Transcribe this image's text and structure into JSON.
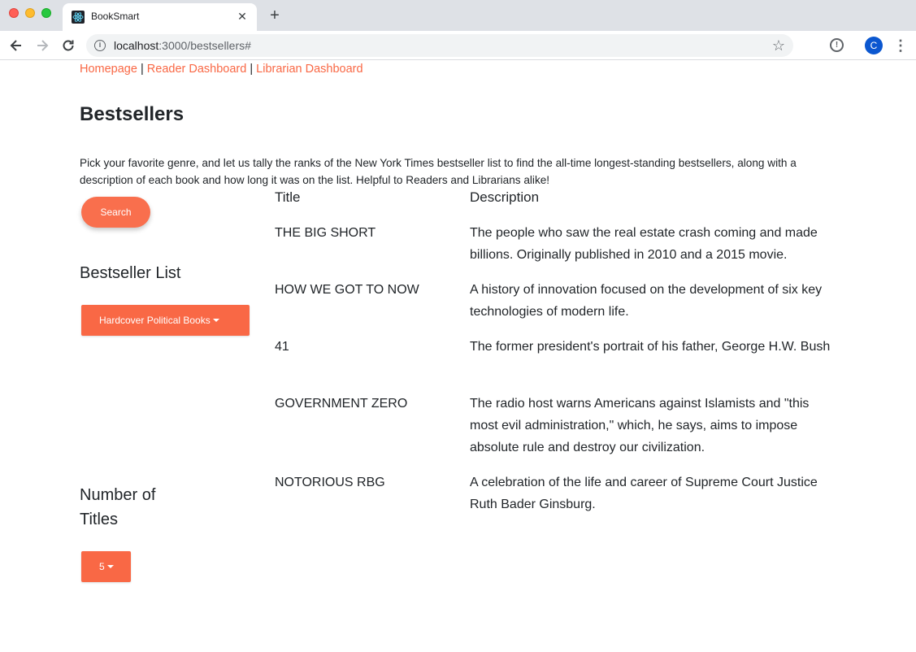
{
  "browser": {
    "tab_title": "BookSmart",
    "tab_close": "✕",
    "new_tab": "+",
    "url_host": "localhost",
    "url_path": ":3000/bestsellers#",
    "avatar_letter": "C"
  },
  "nav": {
    "homepage": "Homepage",
    "sep1": "|",
    "reader_dashboard": "Reader Dashboard",
    "sep2": "|",
    "librarian_dashboard": "Librarian Dashboard"
  },
  "page": {
    "title": "Bestsellers",
    "intro": "Pick your favorite genre, and let us tally the ranks of the New York Times bestseller list to find the all-time longest-standing bestsellers, along with a description of each book and how long it was on the list. Helpful to Readers and Librarians alike!",
    "search_label": "Search",
    "list_label": "Bestseller List",
    "genre_selected": "Hardcover Political Books",
    "count_label": "Number of Titles",
    "count_selected": "5"
  },
  "results": {
    "header_title": "Title",
    "header_description": "Description",
    "rows": [
      {
        "title": "THE BIG SHORT",
        "description": "The people who saw the real estate crash coming and made billions. Originally published in 2010 and a 2015 movie."
      },
      {
        "title": "HOW WE GOT TO NOW",
        "description": "A history of innovation focused on the development of six key technologies of modern life."
      },
      {
        "title": "41",
        "description": "The former president's portrait of his father, George H.W. Bush"
      },
      {
        "title": "GOVERNMENT ZERO",
        "description": "The radio host warns Americans against Islamists and \"this most evil administration,\" which, he says, aims to impose absolute rule and destroy our civilization."
      },
      {
        "title": "NOTORIOUS RBG",
        "description": "A celebration of the life and career of Supreme Court Justice Ruth Bader Ginsburg."
      }
    ]
  },
  "colors": {
    "accent": "#f96845",
    "link": "#f96845"
  }
}
